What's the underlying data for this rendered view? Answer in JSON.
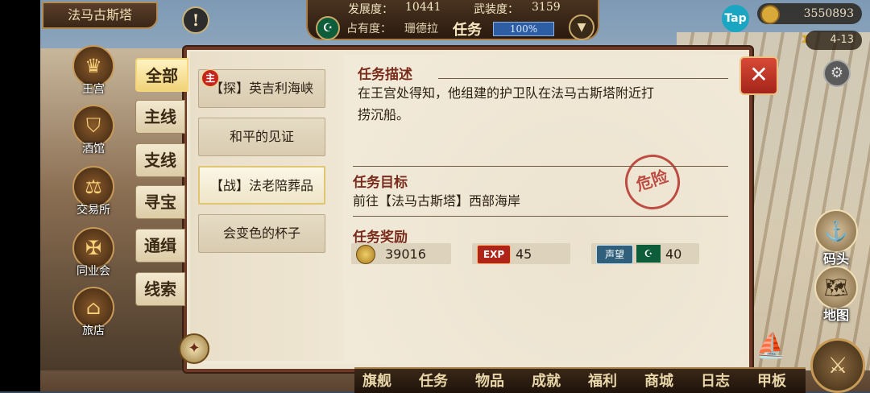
{
  "topbar": {
    "city": "法马古斯塔",
    "development_label": "发展度：",
    "development_value": "10441",
    "armament_label": "武装度：",
    "armament_value": "3159",
    "occupancy_label": "占有度：",
    "occupancy_owner": "珊德拉",
    "screen_title": "任务",
    "occupancy_percent": "100%",
    "tap_label": "Tap",
    "gold": "3550893",
    "date": "4-13"
  },
  "left_city": [
    {
      "label": "王宫",
      "icon": "crown-icon"
    },
    {
      "label": "酒馆",
      "icon": "tavern-icon"
    },
    {
      "label": "交易所",
      "icon": "scales-icon"
    },
    {
      "label": "同业会",
      "icon": "guild-icon"
    },
    {
      "label": "旅店",
      "icon": "inn-icon"
    }
  ],
  "right_dock": [
    {
      "label": "码头",
      "icon": "dock-icon"
    },
    {
      "label": "地图",
      "icon": "map-icon"
    }
  ],
  "categories": [
    "全部",
    "主线",
    "支线",
    "寻宝",
    "通缉",
    "线索"
  ],
  "active_category": "全部",
  "quests": [
    {
      "label": "【探】英吉利海峡",
      "badge": "主"
    },
    {
      "label": "和平的见证"
    },
    {
      "label": "【战】法老陪葬品",
      "selected": true
    },
    {
      "label": "会变色的杯子"
    }
  ],
  "detail": {
    "desc_heading": "任务描述",
    "desc_line1": "在王宫处得知，他组建的护卫队在法马古斯塔附近打",
    "desc_line2": "捞沉船。",
    "stamp": "危险",
    "goal_heading": "任务目标",
    "goal_text": "前往【法马古斯塔】西部海岸",
    "reward_heading": "任务奖励",
    "reward_gold": "39016",
    "exp_label": "EXP",
    "reward_exp": "45",
    "reputation_label": "声望",
    "reward_reputation": "40"
  },
  "bottom_nav": [
    "旗舰",
    "任务",
    "物品",
    "成就",
    "福利",
    "商城",
    "日志",
    "甲板"
  ],
  "colors": {
    "accent": "#7a2c1c",
    "panel": "#efe6d3",
    "frame": "#6b3a26",
    "close": "#c23a2a"
  }
}
